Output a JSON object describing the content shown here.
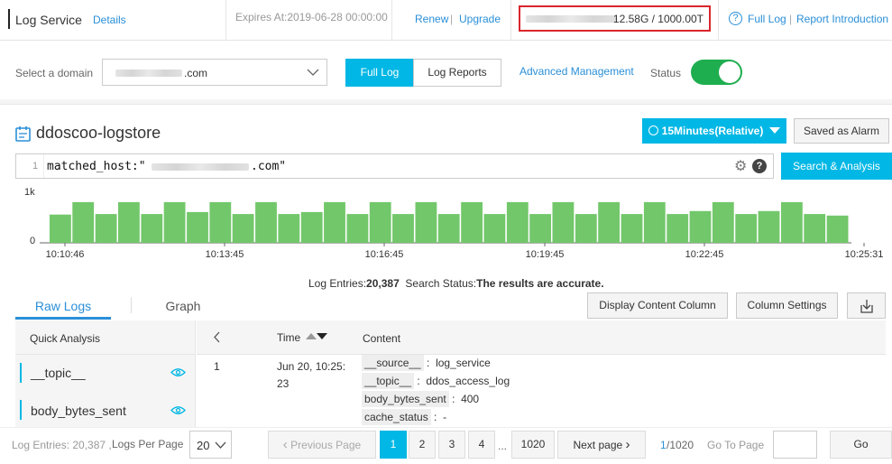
{
  "header": {
    "service_title": "Log Service",
    "details_link": "Details",
    "expires": "Expires At:2019-06-28 00:00:00",
    "renew": "Renew",
    "upgrade": "Upgrade",
    "separator": "|",
    "usage": "12.58G / 1000.00T",
    "full_log": "Full Log",
    "report_intro": "Report Introduction"
  },
  "domain_bar": {
    "label": "Select a domain",
    "domain_suffix": ".com",
    "tabs": [
      "Full Log",
      "Log Reports"
    ],
    "advanced": "Advanced Management",
    "status_label": "Status",
    "status_on": true
  },
  "logstore": {
    "name": "ddoscoo-logstore",
    "time_range": "15Minutes(Relative)",
    "saved_alarm": "Saved as Alarm",
    "query_line_no": "1",
    "query_prefix": "matched_host:\"",
    "query_suffix": ".com\"",
    "search_button": "Search & Analysis"
  },
  "histogram": {
    "y_max_label": "1k",
    "y_min_label": "0",
    "x_labels": [
      "10:10:46",
      "10:13:45",
      "10:16:45",
      "10:19:45",
      "10:22:45",
      "10:25:31"
    ],
    "bar_color": "#72c76a"
  },
  "chart_data": {
    "type": "bar",
    "ylim": [
      0,
      1000
    ],
    "values": [
      570,
      820,
      580,
      820,
      580,
      820,
      620,
      820,
      580,
      820,
      580,
      620,
      820,
      580,
      820,
      580,
      820,
      580,
      820,
      580,
      820,
      580,
      820,
      580,
      820,
      580,
      820,
      580,
      640,
      820,
      580,
      640,
      820,
      580,
      550
    ]
  },
  "status_line": {
    "entries_label": "Log Entries:",
    "entries_value": "20,387",
    "search_status_label": "Search Status:",
    "search_status_value": "The results are accurate."
  },
  "results": {
    "tabs": [
      "Raw Logs",
      "Graph"
    ],
    "display_content_column": "Display Content Column",
    "column_settings": "Column Settings",
    "quick_analysis": "Quick Analysis",
    "fields": [
      "__topic__",
      "body_bytes_sent"
    ],
    "col_time": "Time",
    "col_content": "Content",
    "rows": [
      {
        "index": "1",
        "time_line1": "Jun 20, 10:25:",
        "time_line2": "23",
        "fields": [
          {
            "key": "__source__",
            "value": "log_service"
          },
          {
            "key": "__topic__",
            "value": "ddos_access_log"
          },
          {
            "key": "body_bytes_sent",
            "value": "400"
          },
          {
            "key": "cache_status",
            "value": "-"
          }
        ]
      }
    ]
  },
  "pagination": {
    "entries_text": "Log Entries: 20,387 ,",
    "per_page_label": "Logs Per Page",
    "per_page_value": "20",
    "prev": "Previous Page",
    "pages": [
      "1",
      "2",
      "3",
      "4"
    ],
    "ellipsis": "...",
    "last_page": "1020",
    "next": "Next page",
    "page_current": "1",
    "page_total": "/1020",
    "goto_label": "Go To Page",
    "go": "Go"
  }
}
